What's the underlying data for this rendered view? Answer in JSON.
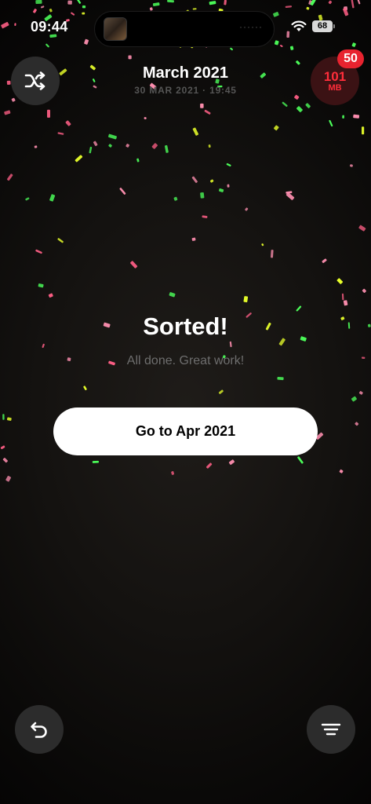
{
  "status_bar": {
    "time": "09:44",
    "battery": "68",
    "island_dots": "······"
  },
  "header": {
    "title": "March 2021",
    "subtitle": "30 MAR 2021 · 19:45"
  },
  "storage": {
    "value": "101",
    "unit": "MB",
    "badge_count": "50"
  },
  "main": {
    "heading": "Sorted!",
    "message": "All done. Great work!",
    "next_button_label": "Go to Apr 2021"
  },
  "icons": {
    "shuffle": "shuffle-icon",
    "undo": "undo-icon",
    "filter": "filter-lines-icon",
    "wifi": "wifi-icon"
  },
  "colors": {
    "accent_red": "#ff2d3a",
    "badge_red": "#e8232f",
    "button_bg": "#ffffff",
    "confetti": [
      "#ff8fb0",
      "#4cff5a",
      "#e8ff2a",
      "#ff5f86"
    ]
  }
}
